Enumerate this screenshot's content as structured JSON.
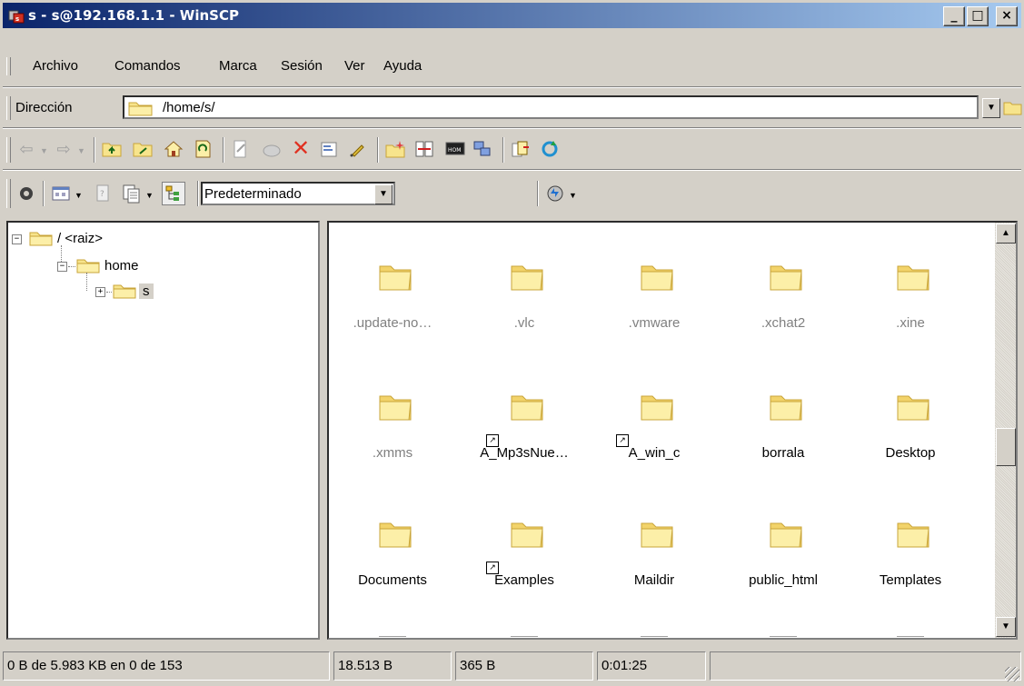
{
  "window": {
    "title": "s - s@192.168.1.1 - WinSCP"
  },
  "titlebar_buttons": {
    "minimize": "_",
    "maximize": "□",
    "close": "×"
  },
  "menu": [
    {
      "label": "Archivo"
    },
    {
      "label": "Comandos"
    },
    {
      "label": "Marca"
    },
    {
      "label": "Sesión"
    },
    {
      "label": "Ver"
    },
    {
      "label": "Ayuda"
    }
  ],
  "address": {
    "label": "Dirección",
    "value": "/home/s/"
  },
  "toolbar2": {
    "preset": "Predeterminado"
  },
  "tree": [
    {
      "label": "/ <raiz>"
    },
    {
      "label": "home"
    },
    {
      "label": "s"
    }
  ],
  "files": [
    {
      "name": ".update-no…",
      "hidden": true,
      "link": false
    },
    {
      "name": ".vlc",
      "hidden": true,
      "link": false
    },
    {
      "name": ".vmware",
      "hidden": true,
      "link": false
    },
    {
      "name": ".xchat2",
      "hidden": true,
      "link": false
    },
    {
      "name": ".xine",
      "hidden": true,
      "link": false
    },
    {
      "name": ".xmms",
      "hidden": true,
      "link": false
    },
    {
      "name": "A_Mp3sNue…",
      "hidden": false,
      "link": true
    },
    {
      "name": "A_win_c",
      "hidden": false,
      "link": true
    },
    {
      "name": "borrala",
      "hidden": false,
      "link": false
    },
    {
      "name": "Desktop",
      "hidden": false,
      "link": false
    },
    {
      "name": "Documents",
      "hidden": false,
      "link": false
    },
    {
      "name": "Examples",
      "hidden": false,
      "link": true
    },
    {
      "name": "Maildir",
      "hidden": false,
      "link": false
    },
    {
      "name": "public_html",
      "hidden": false,
      "link": false
    },
    {
      "name": "Templates",
      "hidden": false,
      "link": false
    }
  ],
  "status": {
    "selection": "0 B de 5.983 KB en 0 de 153",
    "bytes_received": "18.513 B",
    "bytes_sent": "365 B",
    "duration": "0:01:25"
  },
  "colors": {
    "titlebar_start": "#0a246a",
    "titlebar_end": "#a6caf0",
    "folder_fill": "#f7e48c",
    "folder_stroke": "#c9a53a"
  }
}
